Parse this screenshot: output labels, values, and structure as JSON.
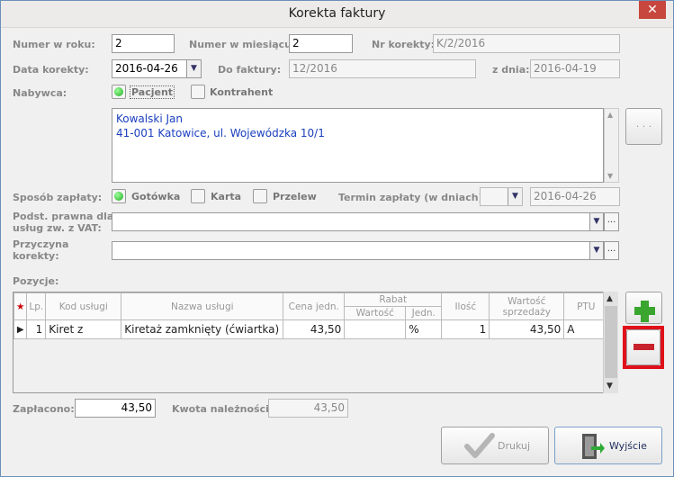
{
  "window": {
    "title": "Korekta faktury",
    "close_glyph": "✕"
  },
  "form": {
    "numer_w_roku_label": "Numer w roku:",
    "numer_w_roku": "2",
    "numer_w_miesiacu_label": "Numer w miesiącu:",
    "numer_w_miesiacu": "2",
    "nr_korekty_label": "Nr korekty:",
    "nr_korekty": "K/2/2016",
    "data_korekty_label": "Data korekty:",
    "data_korekty": "2016-04-26",
    "do_faktury_label": "Do faktury:",
    "do_faktury": "12/2016",
    "z_dnia_label": "z dnia:",
    "z_dnia": "2016-04-19",
    "nabywca_label": "Nabywca:",
    "pacjent_label": "Pacjent",
    "kontrahent_label": "Kontrahent",
    "address_line1": "Kowalski Jan",
    "address_line2": "41-001 Katowice, ul. Wojewódzka 10/1",
    "ellipsis_button": "· · ·",
    "sposob_zaplaty_label": "Sposób zapłaty:",
    "gotowka_label": "Gotówka",
    "karta_label": "Karta",
    "przelew_label": "Przelew",
    "termin_label": "Termin zapłaty (w dniach):",
    "termin_date": "2016-04-26",
    "podst_label_line1": "Podst. prawna dla",
    "podst_label_line2": "usług zw. z VAT:",
    "przyczyna_label_line1": "Przyczyna",
    "przyczyna_label_line2": "korekty:",
    "small_ellipsis": "..."
  },
  "positions": {
    "label": "Pozycje:",
    "headers": {
      "star": "★",
      "lp": "Lp.",
      "kod": "Kod usługi",
      "nazwa": "Nazwa usługi",
      "cena": "Cena jedn.",
      "rabat": "Rabat",
      "wartosc": "Wartość",
      "jedn": "Jedn.",
      "ilosc": "Ilość",
      "wartosc_sprz_1": "Wartość",
      "wartosc_sprz_2": "sprzedaży",
      "ptu": "PTU"
    },
    "rows": [
      {
        "lp": "1",
        "kod": "Kiret z",
        "nazwa": "Kiretaż zamknięty (ćwiartka)",
        "cena": "43,50",
        "rabat_wartosc": "",
        "rabat_jedn": "%",
        "ilosc": "1",
        "wartosc": "43,50",
        "ptu": "A"
      }
    ]
  },
  "totals": {
    "zaplacono_label": "Zapłacono:",
    "zaplacono": "43,50",
    "kwota_label": "Kwota należności:",
    "kwota": "43,50"
  },
  "buttons": {
    "drukuj": "Drukuj",
    "wyjscie": "Wyjście",
    "add_glyph": "+",
    "remove_glyph": "−"
  },
  "colors": {
    "accent_red": "#e0101a",
    "link_blue": "#1a3fbf",
    "plus_green": "#3aa52f",
    "minus_red": "#c8232c"
  }
}
